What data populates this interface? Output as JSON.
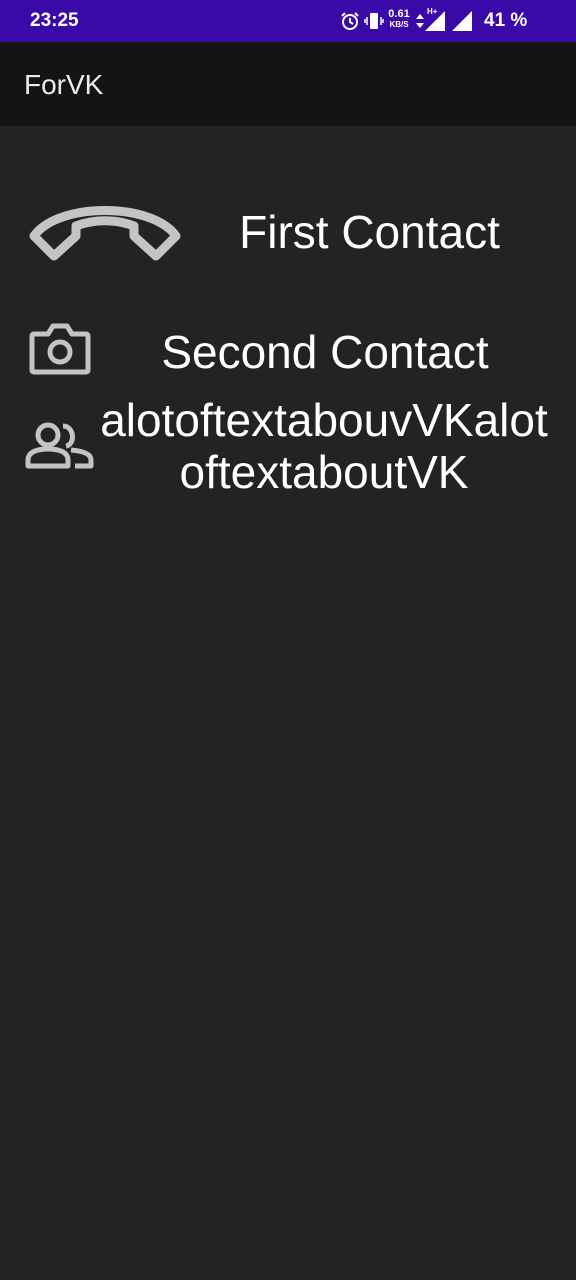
{
  "status_bar": {
    "time": "23:25",
    "netspeed_value": "0.61",
    "netspeed_unit": "KB/S",
    "network_type": "H+",
    "battery": "41 %"
  },
  "app_bar": {
    "title": "ForVK"
  },
  "contacts": [
    {
      "icon": "phone-icon",
      "name": "First Contact"
    },
    {
      "icon": "camera-icon",
      "name": "Second Contact"
    },
    {
      "icon": "group-icon",
      "name": "alotoftextabouvVKalotoftextaboutVK"
    }
  ],
  "colors": {
    "status_bar": "#3a0aa8",
    "app_bar": "#141414",
    "background": "#232323",
    "icon": "#c4c4c4",
    "text": "#ffffff"
  }
}
